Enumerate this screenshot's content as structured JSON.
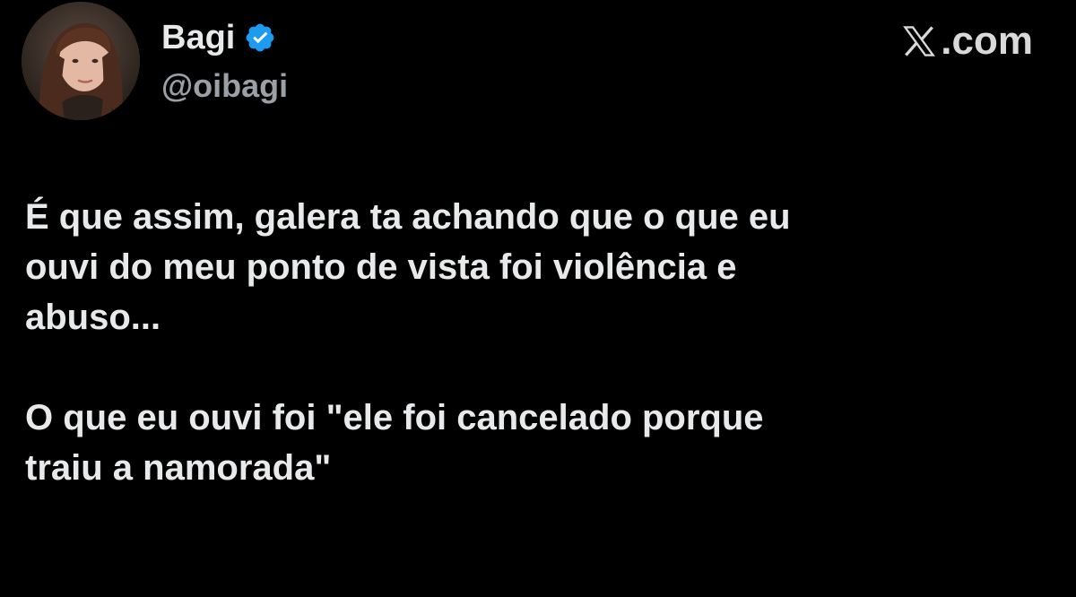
{
  "author": {
    "display_name": "Bagi",
    "handle": "@oibagi",
    "verified_icon": "verified-badge-icon",
    "avatar_icon": "profile-avatar"
  },
  "watermark": {
    "logo_icon": "x-logo-icon",
    "text": ".com"
  },
  "tweet": {
    "paragraphs": [
      "É que assim, galera ta achando que o que eu\nouvi do meu ponto de vista foi violência e\nabuso...",
      "O que eu ouvi foi \"ele foi cancelado porque\ntraiu a namorada\""
    ]
  },
  "colors": {
    "background": "#000000",
    "text_primary": "#e7e9ea",
    "text_secondary": "#9aa0a6",
    "verified_blue": "#1d9bf0"
  }
}
